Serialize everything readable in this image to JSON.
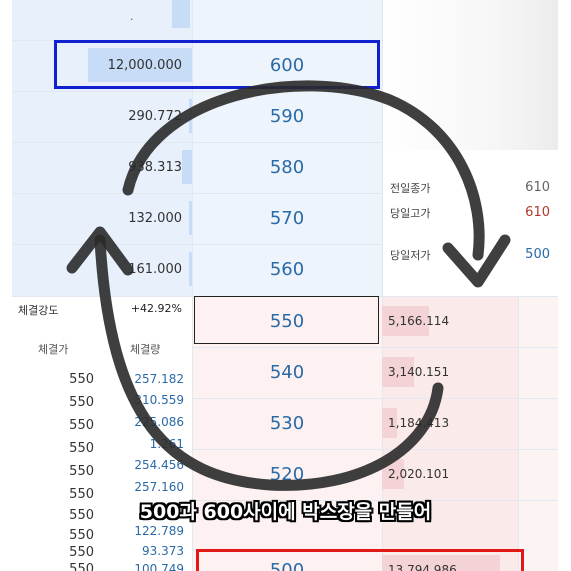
{
  "ask_rows": [
    {
      "volume": "12,000.000",
      "price": "600",
      "bar": 0.62
    },
    {
      "volume": "290.772",
      "price": "590",
      "bar": 0.02
    },
    {
      "volume": "938.313",
      "price": "580",
      "bar": 0.06
    },
    {
      "volume": "132.000",
      "price": "570",
      "bar": 0.02
    },
    {
      "volume": "161.000",
      "price": "560",
      "bar": 0.02
    }
  ],
  "bid_rows": [
    {
      "price": "550",
      "volume": "5,166.114",
      "bar": 0.38
    },
    {
      "price": "540",
      "volume": "3,140.151",
      "bar": 0.26
    },
    {
      "price": "530",
      "volume": "1,184.413",
      "bar": 0.12
    },
    {
      "price": "520",
      "volume": "2,020.101",
      "bar": 0.18
    },
    {
      "price": "500",
      "volume": "13,794.986",
      "bar": 0.95
    }
  ],
  "info": {
    "prev_close_label": "전일종가",
    "prev_close": "610",
    "high_label": "당일고가",
    "high": "610",
    "low_label": "당일저가",
    "low": "500"
  },
  "strength": {
    "label": "체결강도",
    "value": "+42.92%"
  },
  "executions": {
    "price_header": "체결가",
    "volume_header": "체결량",
    "rows": [
      {
        "price": "550",
        "volume": "257.182"
      },
      {
        "price": "550",
        "volume": "310.559"
      },
      {
        "price": "550",
        "volume": "225.086"
      },
      {
        "price": "550",
        "volume": "1.261"
      },
      {
        "price": "550",
        "volume": "254.456"
      },
      {
        "price": "550",
        "volume": "257.160"
      },
      {
        "price": "550",
        "volume": ""
      },
      {
        "price": "550",
        "volume": "122.789"
      },
      {
        "price": "550",
        "volume": "93.373"
      },
      {
        "price": "550",
        "volume": "100.749"
      }
    ]
  },
  "caption": "500과 600사이에 박스장을 만들어",
  "colors": {
    "blue_box": "#1020d0",
    "red_box": "#e01818",
    "price_text": "#2a6aa6",
    "info_high": "#b03a2e",
    "info_low": "#2a6aa6"
  }
}
